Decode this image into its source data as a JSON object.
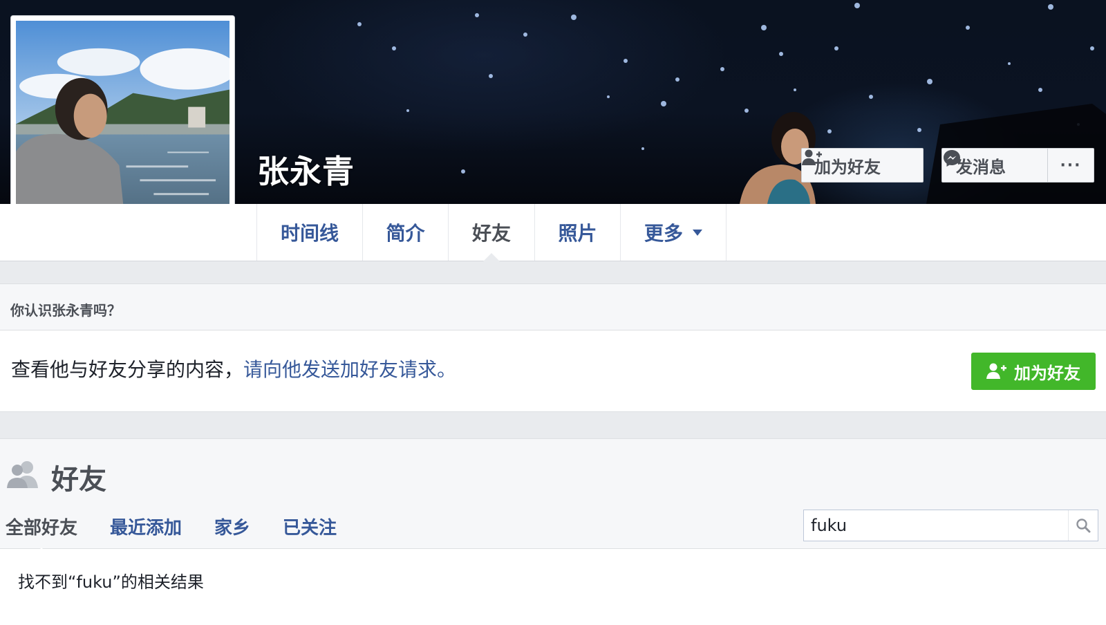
{
  "profile": {
    "name": "张永青",
    "actions": {
      "add_friend": "加为好友",
      "message": "发消息",
      "more": "···"
    }
  },
  "tabs": [
    {
      "label": "时间线"
    },
    {
      "label": "简介"
    },
    {
      "label": "好友",
      "active": true
    },
    {
      "label": "照片"
    },
    {
      "label": "更多"
    }
  ],
  "know_card": {
    "title": "你认识张永青吗？",
    "text": "查看他与好友分享的内容，",
    "link": "请向他发送加好友请求。",
    "button": "加为好友"
  },
  "friends": {
    "title": "好友",
    "subtabs": [
      "全部好友",
      "最近添加",
      "家乡",
      "已关注"
    ],
    "search_value": "fuku",
    "empty_message": "找不到“fuku”的相关结果"
  },
  "colors": {
    "link": "#365899",
    "green": "#42b72a",
    "page_bg": "#e9ebee"
  },
  "icons": {
    "add_friend": "add-friend-icon",
    "message": "messenger-icon",
    "friends": "friends-icon",
    "search": "search-icon",
    "caret": "caret-down-icon"
  }
}
